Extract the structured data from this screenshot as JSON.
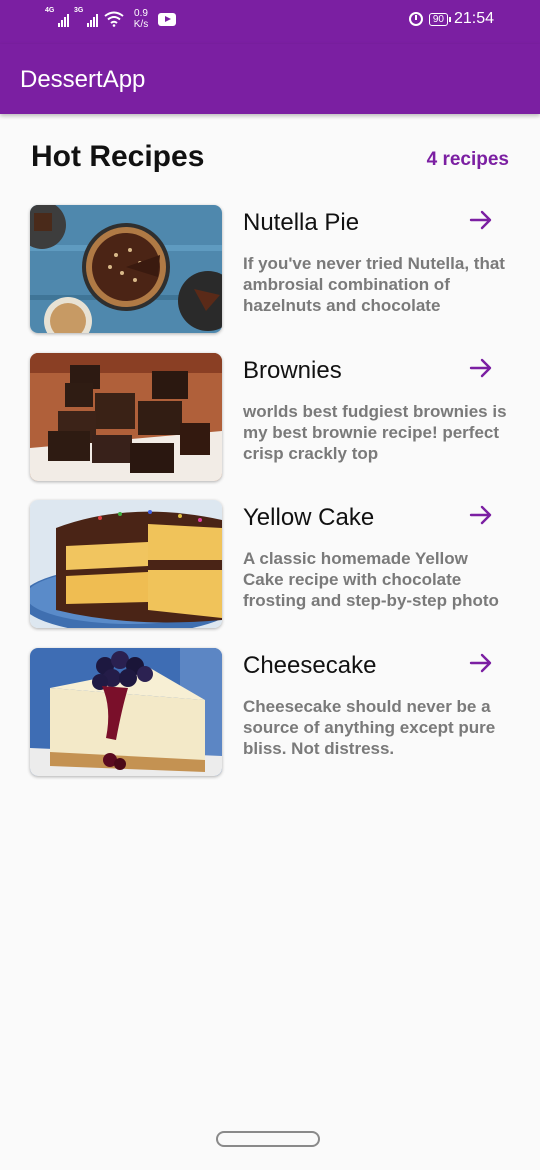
{
  "status_bar": {
    "network_1": "4G",
    "network_2": "3G",
    "speed_value": "0.9",
    "speed_unit": "K/s",
    "battery": "90",
    "time": "21:54"
  },
  "app_bar": {
    "title": "DessertApp"
  },
  "section": {
    "title": "Hot Recipes",
    "count_label": "4 recipes"
  },
  "colors": {
    "primary": "#7b1fa2",
    "description": "#7a7a7a"
  },
  "recipes": [
    {
      "title": "Nutella Pie",
      "description": "If you've never tried Nutella, that ambrosial combination of hazelnuts and chocolate",
      "image": "nutella-pie-photo"
    },
    {
      "title": "Brownies",
      "description": "worlds best fudgiest brownies is my best brownie recipe! perfect crisp crackly top",
      "image": "brownies-photo"
    },
    {
      "title": "Yellow Cake",
      "description": "A classic homemade Yellow Cake recipe with chocolate frosting and step-by-step photo",
      "image": "yellow-cake-photo"
    },
    {
      "title": "Cheesecake",
      "description": "Cheesecake should never be a source of anything except pure bliss. Not distress.",
      "image": "cheesecake-photo"
    }
  ]
}
